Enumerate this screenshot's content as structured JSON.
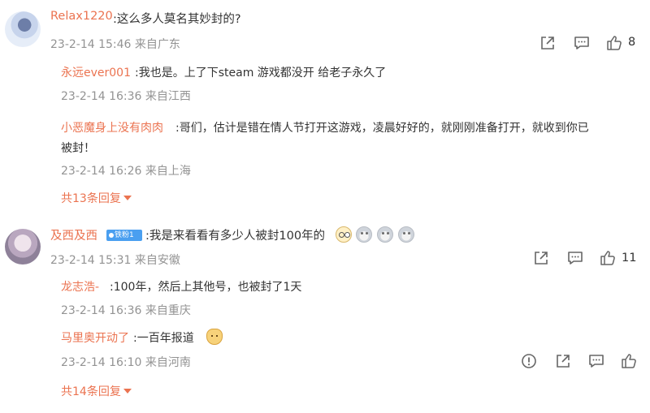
{
  "comments": [
    {
      "user": "Relax1220",
      "text": ":这么多人莫名其妙封的?",
      "time": "23-2-14 15:46 来自广东",
      "like_count": "8",
      "replies": [
        {
          "user": "永远ever001",
          "text": ":我也是。上了下steam 游戏都没开 给老子永久了",
          "time": "23-2-14 16:36 来自江西"
        },
        {
          "user": "小恶魔身上没有肉肉",
          "text": ":哥们，估计是错在情人节打开这游戏，凌晨好好的，就刚刚准备打开，就收到你已",
          "text2": "被封！",
          "time": "23-2-14 16:26 来自上海"
        }
      ],
      "more_replies": "共13条回复"
    },
    {
      "user": "及西及西",
      "badge": "铁粉1",
      "text": ":我是来看看有多少人被封100年的",
      "time": "23-2-14 15:31 来自安徽",
      "like_count": "11",
      "replies": [
        {
          "user": "龙志浩-",
          "text": ":100年，然后上其他号，也被封了1天",
          "time": "23-2-14 16:36 来自重庆"
        },
        {
          "user": "马里奥开动了",
          "text": ":一百年报道",
          "time": "23-2-14 16:10 来自河南"
        }
      ],
      "more_replies": "共14条回复"
    }
  ],
  "icons": {
    "share": "share-icon",
    "comment": "comment-icon",
    "like": "thumbs-up-icon",
    "report": "report-icon"
  },
  "colors": {
    "username": "#eb7350",
    "text": "#333333",
    "meta": "#939393",
    "badge": "#4a9ff0"
  }
}
